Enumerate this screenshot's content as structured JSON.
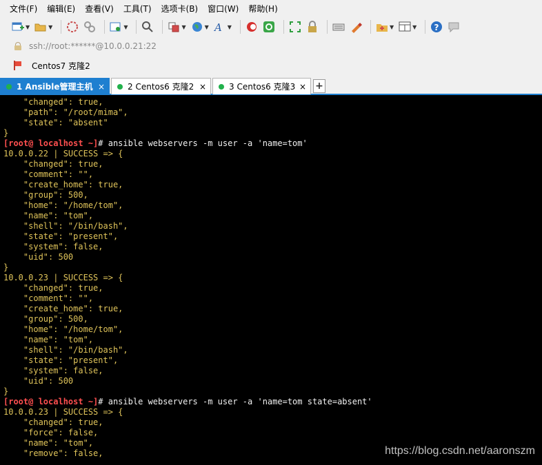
{
  "menu": [
    "文件(F)",
    "编辑(E)",
    "查看(V)",
    "工具(T)",
    "选项卡(B)",
    "窗口(W)",
    "帮助(H)"
  ],
  "address": {
    "url": "ssh://root:******@10.0.0.21:22"
  },
  "session": {
    "label": "Centos7 克隆2"
  },
  "tabs": [
    {
      "label": "1 Ansible管理主机",
      "active": true
    },
    {
      "label": "2 Centos6 克隆2",
      "active": false
    },
    {
      "label": "3 Centos6 克隆3",
      "active": false
    }
  ],
  "tab_close": "×",
  "tab_add": "+",
  "terminal": {
    "lines": [
      {
        "type": "out",
        "text": "    \"changed\": true,"
      },
      {
        "type": "out",
        "text": "    \"path\": \"/root/mima\","
      },
      {
        "type": "out",
        "text": "    \"state\": \"absent\""
      },
      {
        "type": "out",
        "text": "}"
      },
      {
        "type": "cmd",
        "prompt": "[root@ localhost ~]",
        "text": "# ansible webservers -m user -a 'name=tom'"
      },
      {
        "type": "out",
        "text": "10.0.0.22 | SUCCESS => {"
      },
      {
        "type": "out",
        "text": "    \"changed\": true,"
      },
      {
        "type": "out",
        "text": "    \"comment\": \"\","
      },
      {
        "type": "out",
        "text": "    \"create_home\": true,"
      },
      {
        "type": "out",
        "text": "    \"group\": 500,"
      },
      {
        "type": "out",
        "text": "    \"home\": \"/home/tom\","
      },
      {
        "type": "out",
        "text": "    \"name\": \"tom\","
      },
      {
        "type": "out",
        "text": "    \"shell\": \"/bin/bash\","
      },
      {
        "type": "out",
        "text": "    \"state\": \"present\","
      },
      {
        "type": "out",
        "text": "    \"system\": false,"
      },
      {
        "type": "out",
        "text": "    \"uid\": 500"
      },
      {
        "type": "out",
        "text": "}"
      },
      {
        "type": "out",
        "text": "10.0.0.23 | SUCCESS => {"
      },
      {
        "type": "out",
        "text": "    \"changed\": true,"
      },
      {
        "type": "out",
        "text": "    \"comment\": \"\","
      },
      {
        "type": "out",
        "text": "    \"create_home\": true,"
      },
      {
        "type": "out",
        "text": "    \"group\": 500,"
      },
      {
        "type": "out",
        "text": "    \"home\": \"/home/tom\","
      },
      {
        "type": "out",
        "text": "    \"name\": \"tom\","
      },
      {
        "type": "out",
        "text": "    \"shell\": \"/bin/bash\","
      },
      {
        "type": "out",
        "text": "    \"state\": \"present\","
      },
      {
        "type": "out",
        "text": "    \"system\": false,"
      },
      {
        "type": "out",
        "text": "    \"uid\": 500"
      },
      {
        "type": "out",
        "text": "}"
      },
      {
        "type": "cmd",
        "prompt": "[root@ localhost ~]",
        "text": "# ansible webservers -m user -a 'name=tom state=absent'"
      },
      {
        "type": "out",
        "text": "10.0.0.23 | SUCCESS => {"
      },
      {
        "type": "out",
        "text": "    \"changed\": true,"
      },
      {
        "type": "out",
        "text": "    \"force\": false,"
      },
      {
        "type": "out",
        "text": "    \"name\": \"tom\","
      },
      {
        "type": "out",
        "text": "    \"remove\": false,"
      }
    ]
  },
  "watermark": "https://blog.csdn.net/aaronszm",
  "colors": {
    "tab_active": "#1e7fd0",
    "prompt": "#ff4f4f",
    "output": "#e0c45a",
    "terminal_bg": "#000000"
  }
}
